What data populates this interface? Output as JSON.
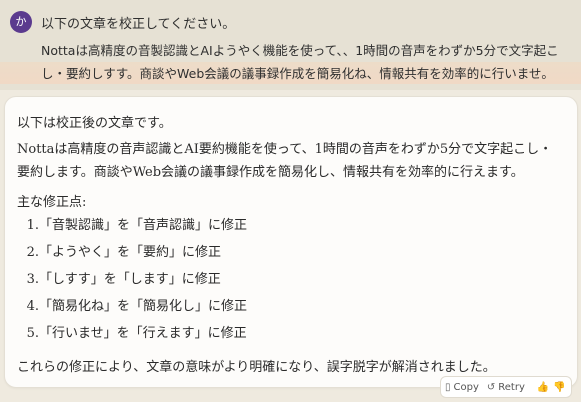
{
  "user": {
    "avatar_letter": "か",
    "line1": "以下の文章を校正してください。",
    "line2": "Nottaは高精度の音製認識とAIようやく機能を使って、、1時間の音声をわずか5分で文字起こし・要約しすす。商談やWeb会議の議事録作成を簡易化ね、情報共有を効率的に行いませ。"
  },
  "assistant": {
    "intro": "以下は校正後の文章です。",
    "corrected": "Nottaは高精度の音声認識とAI要約機能を使って、1時間の音声をわずか5分で文字起こし・要約します。商談やWeb会議の議事録作成を簡易化し、情報共有を効率的に行えます。",
    "heading": "主な修正点:",
    "corrections": [
      {
        "num": "1.",
        "text": "「音製認識」を「音声認識」に修正"
      },
      {
        "num": "2.",
        "text": "「ようやく」を「要約」に修正"
      },
      {
        "num": "3.",
        "text": "「しすす」を「します」に修正"
      },
      {
        "num": "4.",
        "text": "「簡易化ね」を「簡易化し」に修正"
      },
      {
        "num": "5.",
        "text": "「行いませ」を「行えます」に修正"
      }
    ],
    "outro": "これらの修正により、文章の意味がより明確になり、誤字脱字が解消されました。"
  },
  "actions": {
    "copy_label": "Copy",
    "retry_label": "Retry",
    "copy_icon": "clipboard-icon",
    "retry_icon": "retry-icon",
    "thumbs_up_icon": "thumbs-up-icon",
    "thumbs_down_icon": "thumbs-down-icon"
  }
}
